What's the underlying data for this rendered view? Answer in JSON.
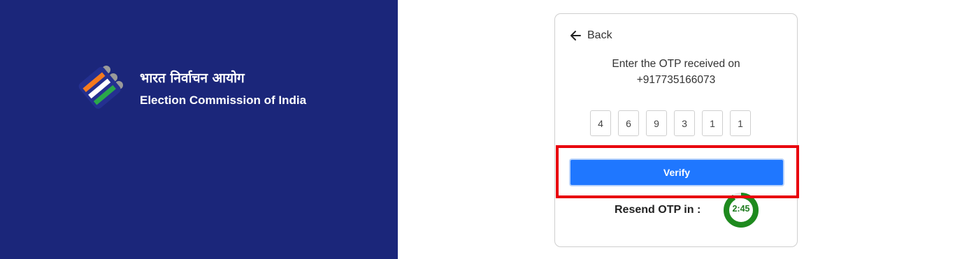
{
  "branding": {
    "hindi_name": "भारत निर्वाचन आयोग",
    "english_name": "Election Commission of India",
    "logo_icon": "eci-ballot-logo-icon",
    "logo_colors": {
      "orange": "#f47a1f",
      "white": "#ffffff",
      "green": "#2aa84a",
      "grey": "#9a9a9a"
    }
  },
  "colors": {
    "left_panel_bg": "#1b267a",
    "primary_button": "#1f77ff",
    "highlight_border": "#e8000b",
    "timer_ring": "#1e8a1e"
  },
  "otp_card": {
    "back_label": "Back",
    "back_icon": "arrow-left-icon",
    "message_line1": "Enter the OTP received on",
    "phone_number": "+917735166073",
    "otp_digits": [
      "4",
      "6",
      "9",
      "3",
      "1",
      "1"
    ],
    "verify_label": "Verify",
    "resend_label": "Resend OTP in :",
    "timer_text": "2:45",
    "timer_remaining_fraction": 0.92
  }
}
